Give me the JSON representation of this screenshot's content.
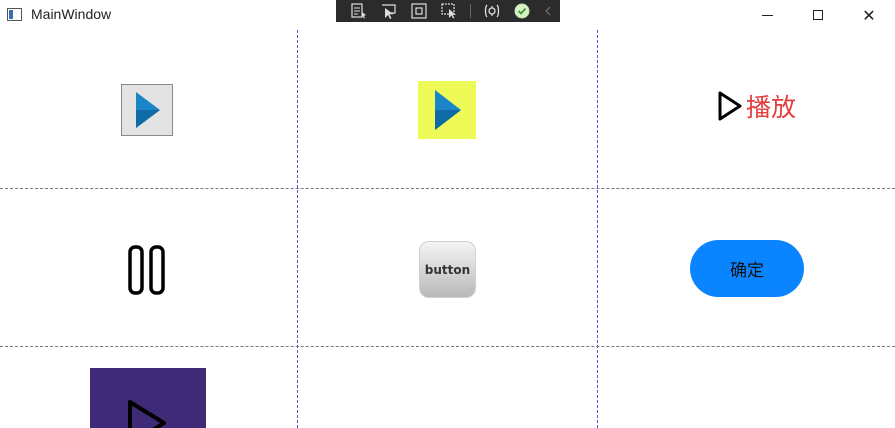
{
  "window": {
    "title": "MainWindow",
    "minimize_icon": "minimize-icon",
    "maximize_icon": "maximize-icon",
    "close_icon": "close-icon",
    "close_glyph": "✕"
  },
  "debug_toolbar": {
    "items": [
      "live-visual-tree-icon",
      "select-element-icon",
      "display-layout-adorners-icon",
      "track-focus-icon",
      "hot-reload-icon",
      "status-ok-icon"
    ]
  },
  "cells": {
    "play_text_label": "播放",
    "gradient_label": "button",
    "confirm_label": "确定"
  },
  "colors": {
    "play_blue": "#1a86c8",
    "yellow_bg": "#eefa57",
    "red_text": "#e23d3d",
    "confirm_blue": "#0a84ff",
    "purple_bg": "#3f2a78"
  }
}
